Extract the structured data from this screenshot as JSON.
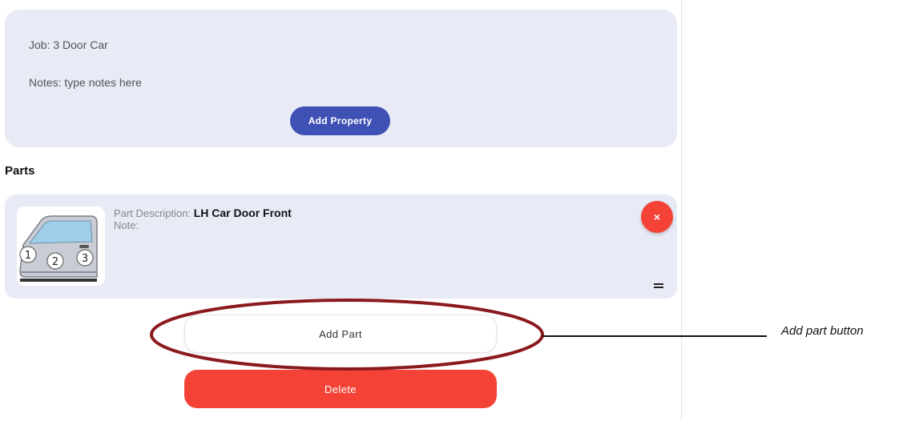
{
  "job": {
    "job_label": "Job:",
    "job_value": "3 Door Car",
    "notes_label": "Notes:",
    "notes_value": "type notes here",
    "add_property_label": "Add Property"
  },
  "parts": {
    "title": "Parts",
    "items": [
      {
        "description_label": "Part Description:",
        "description_value": "LH Car Door Front",
        "note_label": "Note:",
        "note_value": "",
        "thumbnail_numbers": [
          "1",
          "2",
          "3"
        ],
        "remove_label": "×"
      }
    ],
    "add_part_label": "Add Part",
    "delete_label": "Delete"
  },
  "annotation": {
    "callout_text": "Add part button",
    "highlight_color": "#8b1a1f"
  },
  "colors": {
    "card_bg": "#e8eaf6",
    "primary": "#3f51b5",
    "danger": "#f44336"
  }
}
